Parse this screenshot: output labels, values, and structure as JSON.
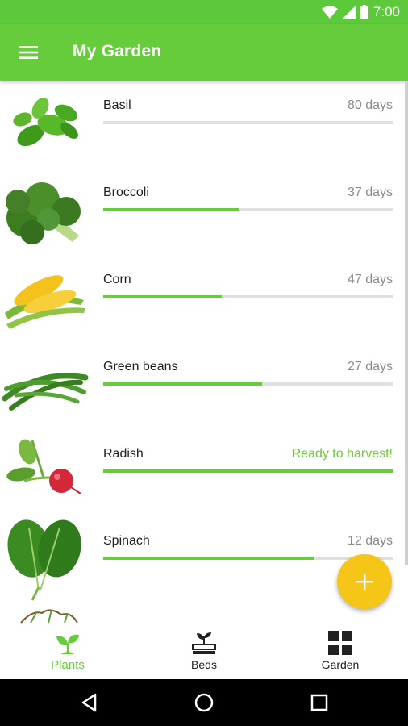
{
  "status_bar": {
    "time": "7:00",
    "icons": [
      "wifi-icon",
      "signal-icon",
      "battery-icon"
    ]
  },
  "app_bar": {
    "title": "My Garden",
    "menu_icon": "hamburger-menu-icon"
  },
  "colors": {
    "primary": "#66cc3c",
    "status_bar": "#5cc93a",
    "accent": "#f5c518",
    "track": "#e0e0e0"
  },
  "plants": [
    {
      "name": "Basil",
      "status": "80 days",
      "progress": 0.0,
      "ready": false,
      "image": "basil-image"
    },
    {
      "name": "Broccoli",
      "status": "37 days",
      "progress": 0.47,
      "ready": false,
      "image": "broccoli-image"
    },
    {
      "name": "Corn",
      "status": "47 days",
      "progress": 0.41,
      "ready": false,
      "image": "corn-image"
    },
    {
      "name": "Green beans",
      "status": "27 days",
      "progress": 0.55,
      "ready": false,
      "image": "green-beans-image"
    },
    {
      "name": "Radish",
      "status": "Ready to harvest!",
      "progress": 1.0,
      "ready": true,
      "image": "radish-image"
    },
    {
      "name": "Spinach",
      "status": "12 days",
      "progress": 0.73,
      "ready": false,
      "image": "spinach-image"
    }
  ],
  "fab": {
    "icon": "plus-icon"
  },
  "bottom_nav": [
    {
      "label": "Plants",
      "icon": "sprout-icon",
      "active": true
    },
    {
      "label": "Beds",
      "icon": "planter-bed-icon",
      "active": false
    },
    {
      "label": "Garden",
      "icon": "grid-icon",
      "active": false
    }
  ],
  "system_nav": [
    "back-icon",
    "home-icon",
    "recents-icon"
  ]
}
